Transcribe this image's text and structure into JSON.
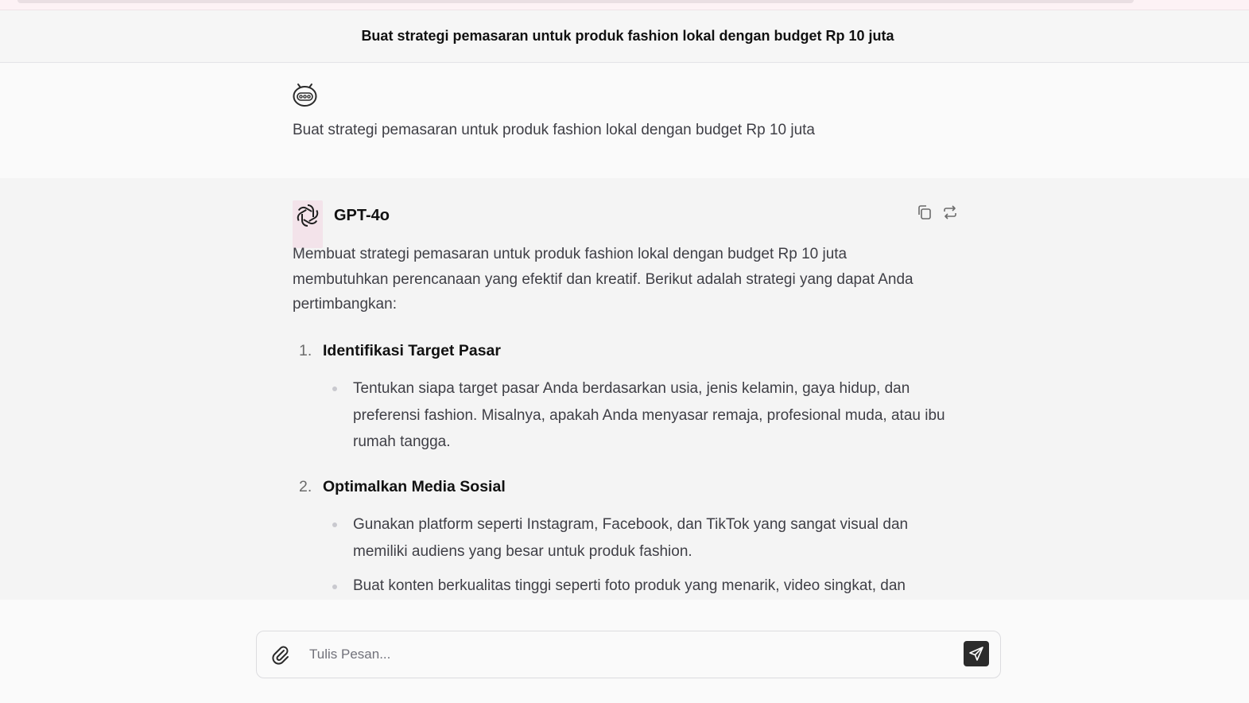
{
  "header": {
    "title": "Buat strategi pemasaran untuk produk fashion lokal dengan budget Rp 10 juta"
  },
  "user_message": {
    "avatar_icon": "robot-face-icon",
    "text": "Buat strategi pemasaran untuk produk fashion lokal dengan budget Rp 10 juta"
  },
  "assistant_message": {
    "avatar_icon": "openai-logo-icon",
    "model_name": "GPT-4o",
    "actions": {
      "copy_icon": "copy-icon",
      "regenerate_icon": "regenerate-icon"
    },
    "intro": "Membuat strategi pemasaran untuk produk fashion lokal dengan budget Rp 10 juta membutuhkan perencanaan yang efektif dan kreatif. Berikut adalah strategi yang dapat Anda pertimbangkan:",
    "sections": [
      {
        "number": "1.",
        "title": "Identifikasi Target Pasar",
        "bullets": [
          "Tentukan siapa target pasar Anda berdasarkan usia, jenis kelamin, gaya hidup, dan preferensi fashion. Misalnya, apakah Anda menyasar remaja, profesional muda, atau ibu rumah tangga."
        ]
      },
      {
        "number": "2.",
        "title": "Optimalkan Media Sosial",
        "bullets": [
          "Gunakan platform seperti Instagram, Facebook, dan TikTok yang sangat visual dan memiliki audiens yang besar untuk produk fashion.",
          "Buat konten berkualitas tinggi seperti foto produk yang menarik, video singkat, dan"
        ]
      }
    ]
  },
  "composer": {
    "placeholder": "Tulis Pesan...",
    "attach_icon": "paperclip-icon",
    "send_icon": "send-icon"
  },
  "colors": {
    "accent_dark": "#2b2b2b",
    "avatar_highlight": "#f3e3ea"
  }
}
